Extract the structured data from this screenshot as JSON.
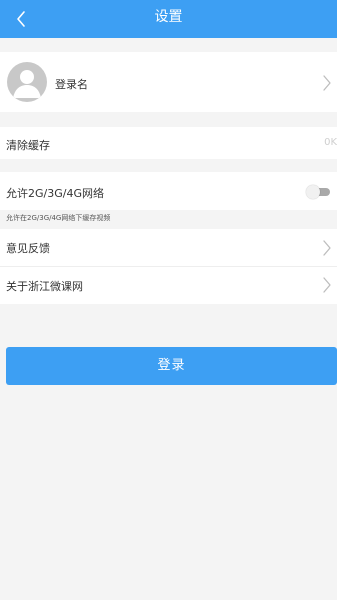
{
  "header": {
    "title": "设置",
    "back_icon": "chevron-left-icon"
  },
  "profile": {
    "login_name": "登录名",
    "avatar_icon": "default-avatar-icon",
    "chevron_icon": "chevron-right-icon"
  },
  "settings": {
    "clear_cache_label": "清除缓存",
    "cache_size": "0K",
    "network_label": "允许2G/3G/4G网络",
    "network_toggle_on": false,
    "network_hint": "允许在2G/3G/4G网络下缓存视频",
    "feedback_label": "意见反馈",
    "about_label": "关于浙江微课网"
  },
  "actions": {
    "login_label": "登录"
  },
  "colors": {
    "accent": "#3d9ff3",
    "background": "#f4f4f4",
    "toggle_off": "#a9a9a9"
  }
}
